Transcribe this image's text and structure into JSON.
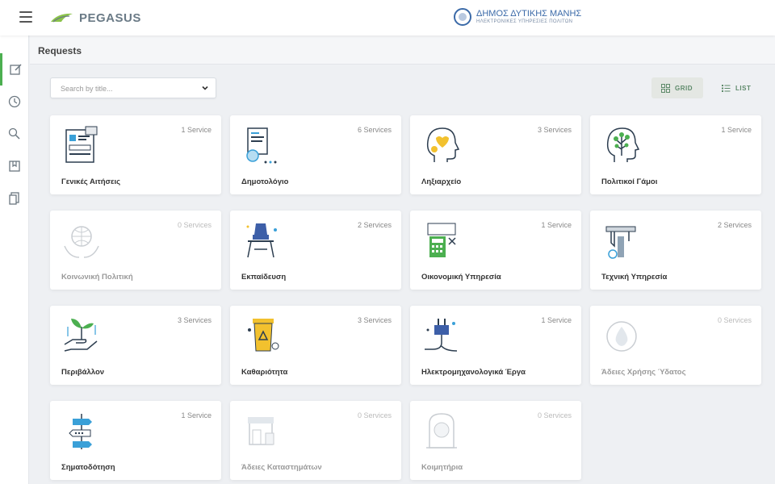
{
  "header": {
    "logo_text": "PEGASUS",
    "municipality_name": "ΔΗΜΟΣ ΔΥΤΙΚΗΣ ΜΑΝΗΣ",
    "municipality_subtitle": "ΗΛΕΚΤΡΟΝΙΚΕΣ ΥΠΗΡΕΣΙΕΣ ΠΟΛΙΤΩΝ"
  },
  "sidebar": {
    "items": [
      {
        "icon": "edit-icon",
        "active": true
      },
      {
        "icon": "history-icon",
        "active": false
      },
      {
        "icon": "search-user-icon",
        "active": false
      },
      {
        "icon": "bookmark-book-icon",
        "active": false
      },
      {
        "icon": "documents-icon",
        "active": false
      }
    ]
  },
  "page": {
    "title": "Requests"
  },
  "search": {
    "placeholder": "Search by title..."
  },
  "view_toggle": {
    "grid_label": "GRID",
    "list_label": "LIST",
    "selected": "grid"
  },
  "colors": {
    "accent_green": "#4caf50",
    "brand_blue": "#3b6aa8",
    "toggle_text": "#5e8a6a"
  },
  "cards": [
    {
      "title": "Γενικές Αιτήσεις",
      "count": "1 Service",
      "icon": "forms-document-icon",
      "disabled": false
    },
    {
      "title": "Δημοτολόγιο",
      "count": "6 Services",
      "icon": "registry-search-icon",
      "disabled": false
    },
    {
      "title": "Ληξιαρχείο",
      "count": "3 Services",
      "icon": "registry-hearts-head-icon",
      "disabled": false
    },
    {
      "title": "Πολιτικοί Γάμοι",
      "count": "1 Service",
      "icon": "tree-head-icon",
      "disabled": false
    },
    {
      "title": "Κοινωνική Πολιτική",
      "count": "0 Services",
      "icon": "globe-hands-icon",
      "disabled": true
    },
    {
      "title": "Εκπαίδευση",
      "count": "2 Services",
      "icon": "school-desk-icon",
      "disabled": false
    },
    {
      "title": "Οικονομική Υπηρεσία",
      "count": "1 Service",
      "icon": "calculator-icon",
      "disabled": false
    },
    {
      "title": "Τεχνική Υπηρεσία",
      "count": "2 Services",
      "icon": "caliper-icon",
      "disabled": false
    },
    {
      "title": "Περιβάλλον",
      "count": "3 Services",
      "icon": "plant-hand-icon",
      "disabled": false
    },
    {
      "title": "Καθαριότητα",
      "count": "3 Services",
      "icon": "recycle-bin-icon",
      "disabled": false
    },
    {
      "title": "Ηλεκτρομηχανολογικά Έργα",
      "count": "1 Service",
      "icon": "electric-plug-icon",
      "disabled": false
    },
    {
      "title": "Άδειες Χρήσης Ύδατος",
      "count": "0 Services",
      "icon": "water-drop-icon",
      "disabled": true
    },
    {
      "title": "Σηματοδότηση",
      "count": "1 Service",
      "icon": "signpost-icon",
      "disabled": false
    },
    {
      "title": "Άδειες Καταστημάτων",
      "count": "0 Services",
      "icon": "shop-icon",
      "disabled": true
    },
    {
      "title": "Κοιμητήρια",
      "count": "0 Services",
      "icon": "cemetery-icon",
      "disabled": true
    }
  ]
}
